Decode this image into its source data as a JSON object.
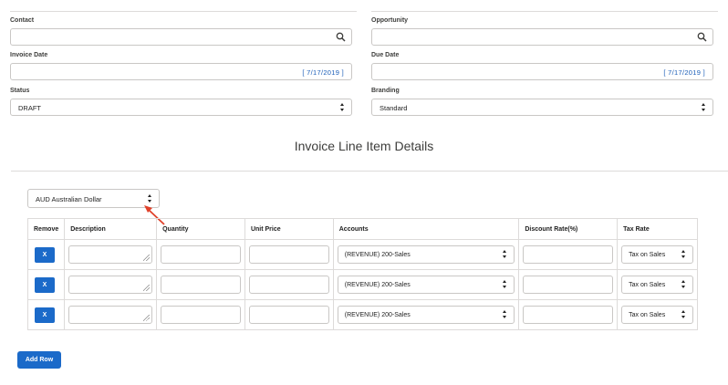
{
  "form": {
    "contact": {
      "label": "Contact",
      "value": ""
    },
    "opportunity": {
      "label": "Opportunity",
      "value": ""
    },
    "invoice_date": {
      "label": "Invoice Date",
      "value": "[ 7/17/2019 ]"
    },
    "due_date": {
      "label": "Due Date",
      "value": "[ 7/17/2019 ]"
    },
    "status": {
      "label": "Status",
      "value": "DRAFT"
    },
    "branding": {
      "label": "Branding",
      "value": "Standard"
    }
  },
  "section_title": "Invoice Line Item Details",
  "currency": {
    "value": "AUD Australian Dollar"
  },
  "table": {
    "headers": [
      "Remove",
      "Description",
      "Quantity",
      "Unit Price",
      "Accounts",
      "Discount Rate(%)",
      "Tax Rate"
    ],
    "rows": [
      {
        "remove_label": "X",
        "description": "",
        "quantity": "",
        "unit_price": "",
        "account": "(REVENUE) 200-Sales",
        "discount": "",
        "tax_rate": "Tax on Sales"
      },
      {
        "remove_label": "X",
        "description": "",
        "quantity": "",
        "unit_price": "",
        "account": "(REVENUE) 200-Sales",
        "discount": "",
        "tax_rate": "Tax on Sales"
      },
      {
        "remove_label": "X",
        "description": "",
        "quantity": "",
        "unit_price": "",
        "account": "(REVENUE) 200-Sales",
        "discount": "",
        "tax_rate": "Tax on Sales"
      }
    ]
  },
  "add_row_label": "Add Row",
  "colors": {
    "accent": "#1b6ac9",
    "date_text": "#1b5eb8",
    "arrow": "#e0412a"
  }
}
